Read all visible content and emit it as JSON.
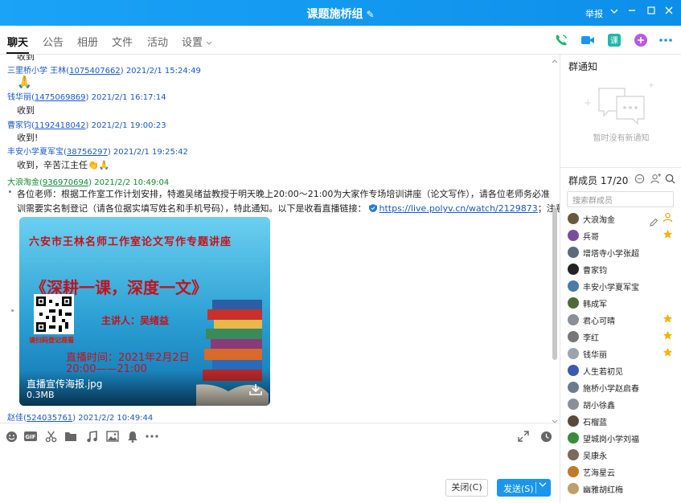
{
  "window": {
    "title": "课题施桥组",
    "report": "举报"
  },
  "tabs": [
    {
      "label": "聊天"
    },
    {
      "label": "公告"
    },
    {
      "label": "相册"
    },
    {
      "label": "文件"
    },
    {
      "label": "活动"
    },
    {
      "label": "设置"
    }
  ],
  "messages": [
    {
      "sender": "三里桥小学 王林",
      "qq": "1075407662",
      "time": "2021/2/1 15:24:49",
      "text": "🙏"
    },
    {
      "sender": "钱华丽",
      "qq": "1475069869",
      "time": "2021/2/1 16:17:14",
      "text": "收到"
    },
    {
      "sender": "曹家钧",
      "qq": "1192418042",
      "time": "2021/2/1 19:00:23",
      "text": "收到!"
    },
    {
      "sender": "丰安小学夏军宝",
      "qq": "38756297",
      "time": "2021/2/1 19:25:42",
      "text": "收到，辛苦江主任👏🙏"
    },
    {
      "sender": "大浪淘金",
      "qq": "936970694",
      "time": "2021/2/2 10:49:04",
      "text1": "各位老师：根据工作室工作计划安排，特邀吴绪益教授于明天晚上20:00～21:00为大家作专场培训讲座（论文写作），请各位老师务必准时参与。此次培",
      "text2": "训需要实名制登记（请各位据实填写姓名和手机号码），特此通知。以下是收看直播链接：",
      "link": "https://live.polyv.cn/watch/2129873",
      "tail": "；注意收藏哦!"
    },
    {
      "sender": "赵佳",
      "qq": "524035761",
      "time": "2021/2/2 10:49:44"
    }
  ],
  "poster": {
    "headline": "六安市王林名师工作室论文写作专题讲座",
    "slogan": "《深耕一课，深度一文》",
    "speaker": "主讲人：吴绪益",
    "qr_caption": "请扫码登记观看",
    "time_line1": "直播时间：2021年2月2日",
    "time_line2": "20:00——21:00",
    "file_name": "直播宣传海报.jpg",
    "file_size": "0.3MB"
  },
  "input": {
    "close_label": "关闭(C)",
    "send_label": "发送(S)"
  },
  "notice": {
    "title": "群通知",
    "empty": "暂时没有新通知"
  },
  "members_panel": {
    "title": "群成员 17/20",
    "search_placeholder": "搜索群成员",
    "items": [
      {
        "name": "大浪淘金",
        "color": "#6b5a3a",
        "badge": "owner"
      },
      {
        "name": "兵哥",
        "color": "#7a4d9a",
        "badge": "star"
      },
      {
        "name": "增塔寺小学张超",
        "color": "#5a6b7c"
      },
      {
        "name": "曹家钧",
        "color": "#222222"
      },
      {
        "name": "丰安小学夏军宝",
        "color": "#4a7aa8"
      },
      {
        "name": "韩成军",
        "color": "#4e6a3a"
      },
      {
        "name": "君心可晴",
        "color": "#8a8f99",
        "badge": "star"
      },
      {
        "name": "李红",
        "color": "#777777",
        "badge": "star"
      },
      {
        "name": "钱华丽",
        "color": "#9aa4ae",
        "badge": "star"
      },
      {
        "name": "人生若初见",
        "color": "#3a5ab0"
      },
      {
        "name": "施桥小学赵启春",
        "color": "#6a7c8e"
      },
      {
        "name": "胡小徐鑫",
        "color": "#8a9099"
      },
      {
        "name": "石榴蓝",
        "color": "#5a4a3a"
      },
      {
        "name": "望城岗小学刘福",
        "color": "#3a8a3a"
      },
      {
        "name": "吴康永",
        "color": "#7c6a5a"
      },
      {
        "name": "艺海星云",
        "color": "#c07a2a"
      },
      {
        "name": "幽雅胡红梅",
        "color": "#c0a06a"
      }
    ]
  }
}
